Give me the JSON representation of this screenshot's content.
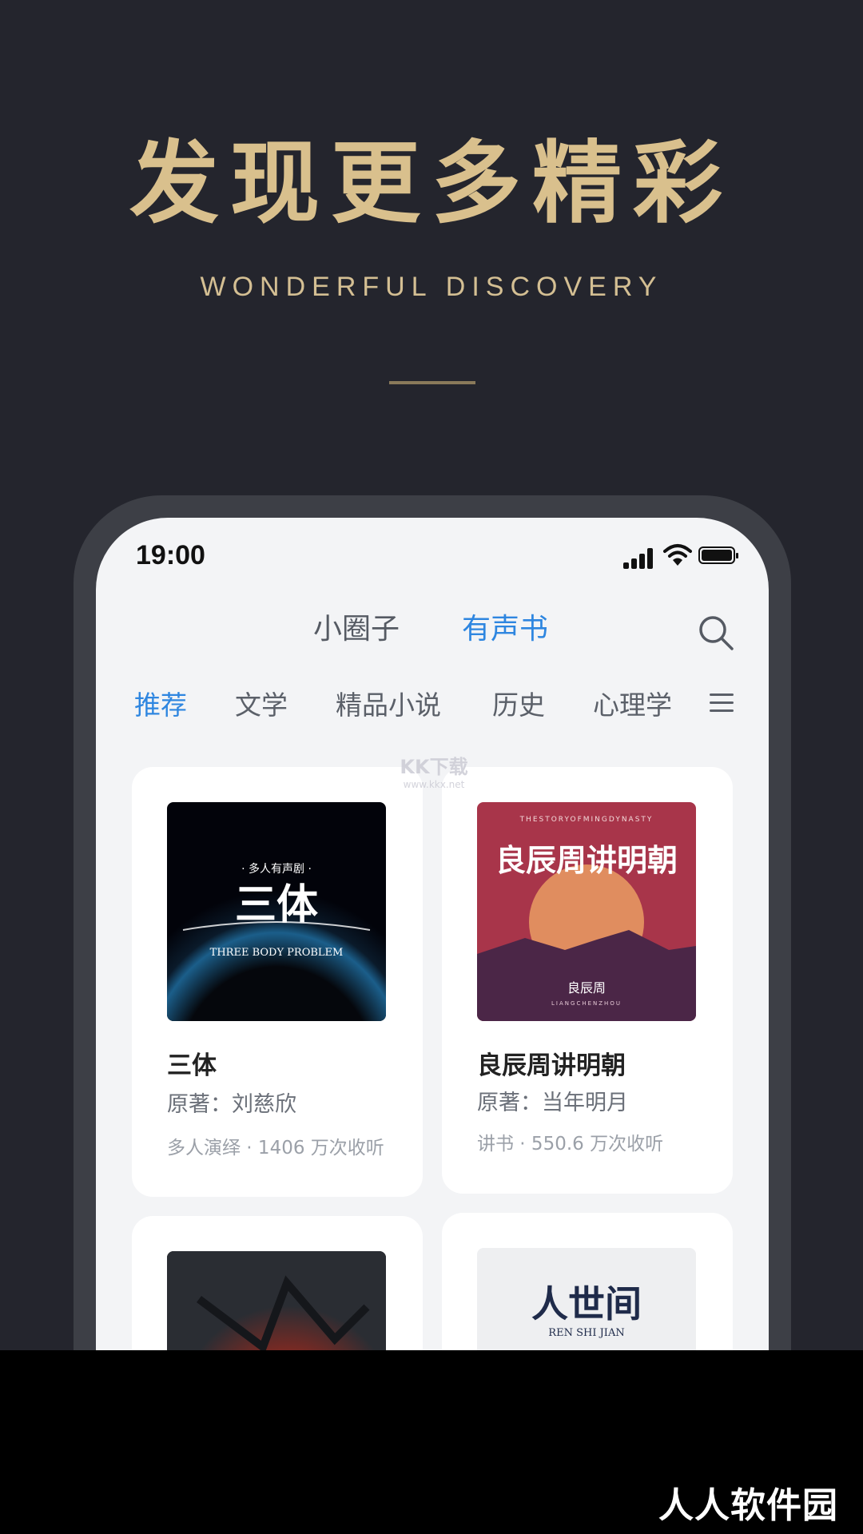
{
  "promo": {
    "headline": "发现更多精彩",
    "subline": "WONDERFUL DISCOVERY"
  },
  "status_bar": {
    "time": "19:00"
  },
  "main_tabs": [
    {
      "label": "小圈子",
      "active": false
    },
    {
      "label": "有声书",
      "active": true
    }
  ],
  "categories": [
    {
      "label": "推荐",
      "active": true
    },
    {
      "label": "文学",
      "active": false
    },
    {
      "label": "精品小说",
      "active": false
    },
    {
      "label": "历史",
      "active": false
    },
    {
      "label": "心理学",
      "active": false
    }
  ],
  "books": [
    {
      "title": "三体",
      "author": "原著：刘慈欣",
      "stats": "多人演绎 · 1406 万次收听",
      "cover": {
        "tag": "· 多人有声剧 ·",
        "main": "三体",
        "sub": "THREE BODY PROBLEM"
      }
    },
    {
      "title": "良辰周讲明朝",
      "author": "原著：当年明月",
      "stats": "讲书 · 550.6 万次收听",
      "cover": {
        "tag": "THESTORYOFMINGDYNASTY",
        "main": "良辰周讲明朝",
        "sub": "良辰周",
        "sub2": "LIANGCHENZHOU"
      }
    },
    {
      "title": "",
      "author": "",
      "stats": "",
      "cover": {}
    },
    {
      "title": "",
      "author": "",
      "stats": "",
      "cover": {
        "main": "人世间",
        "sub": "REN    SHI  JIAN"
      }
    }
  ],
  "watermark": {
    "line1": "KK下载",
    "line2": "www.kkx.net"
  },
  "brand": "人人软件园",
  "colors": {
    "background": "#24252d",
    "gold": "#d9c08d",
    "accent_blue": "#2e86e0"
  }
}
